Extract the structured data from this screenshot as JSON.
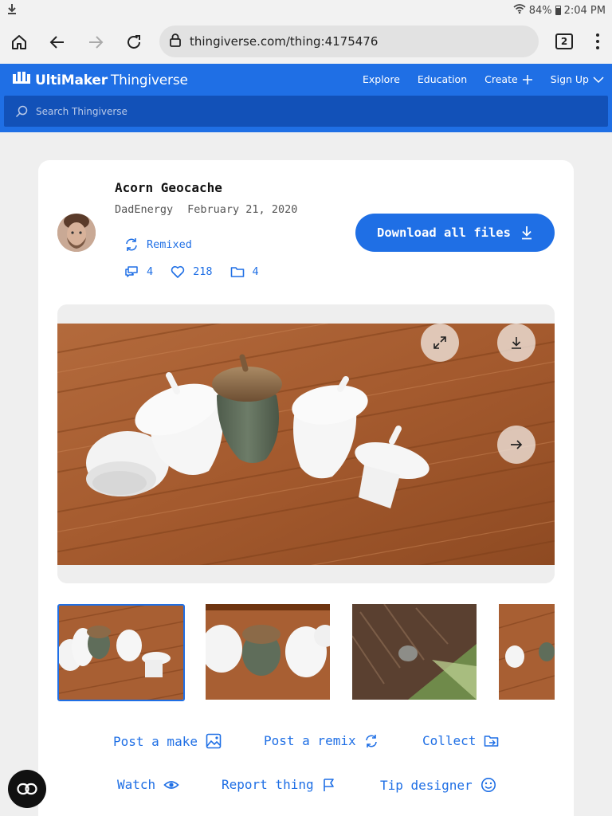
{
  "status_bar": {
    "battery": "84%",
    "time": "2:04 PM"
  },
  "browser": {
    "url": "thingiverse.com/thing:4175476",
    "tab_count": "2"
  },
  "header": {
    "brand_bold": "UltiMaker",
    "brand_light": "Thingiverse",
    "nav": [
      "Explore",
      "Education",
      "Create",
      "Sign Up"
    ],
    "search_placeholder": "Search Thingiverse"
  },
  "thing": {
    "title": "Acorn Geocache",
    "author": "DadEnergy",
    "date": "February 21, 2020",
    "remixed_label": "Remixed",
    "comments": "4",
    "likes": "218",
    "collections": "4",
    "download_label": "Download all files"
  },
  "gallery": {
    "image_count_visible": 4,
    "active_index": 0
  },
  "actions": {
    "post_make": "Post a make",
    "post_remix": "Post a remix",
    "collect": "Collect",
    "watch": "Watch",
    "report": "Report thing",
    "tip": "Tip designer"
  },
  "colors": {
    "brand_blue": "#1f6fe5",
    "search_blue": "#1251b8",
    "card_bg": "#ffffff",
    "page_bg": "#efefef"
  }
}
